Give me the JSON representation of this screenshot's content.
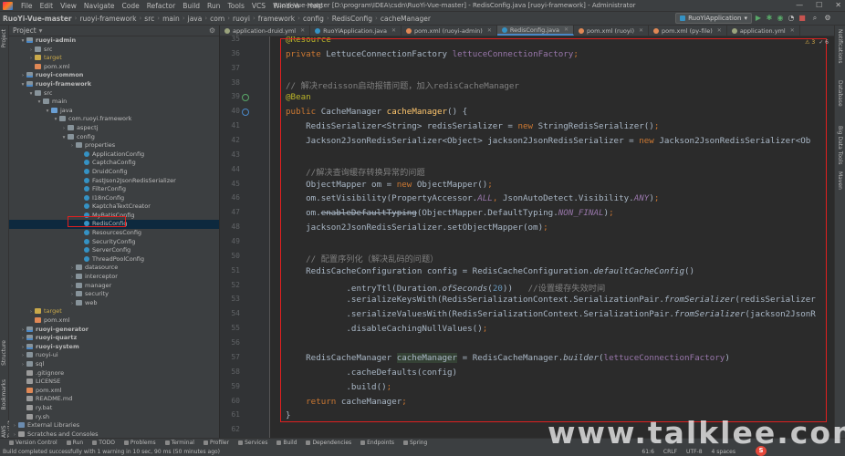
{
  "menubar": {
    "items": [
      "File",
      "Edit",
      "View",
      "Navigate",
      "Code",
      "Refactor",
      "Build",
      "Run",
      "Tools",
      "VCS",
      "Window",
      "Help"
    ],
    "window_title": "RuoYi-Vue-master [D:\\program\\IDEA\\csdn\\RuoYi-Vue-master] - RedisConfig.java [ruoyi-framework] - Administrator",
    "controls": [
      "—",
      "☐",
      "✕"
    ]
  },
  "navbar": {
    "crumbs": [
      "RuoYi-Vue-master",
      "ruoyi-framework",
      "src",
      "main",
      "java",
      "com",
      "ruoyi",
      "framework",
      "config",
      "RedisConfig",
      "cacheManager"
    ],
    "run_config": "RuoYiApplication"
  },
  "left_stripe": {
    "project": "Project",
    "structure": "Structure",
    "bookmarks": "Bookmarks",
    "aws": "AWS Toolkit"
  },
  "right_stripe": {
    "notifications": "Notifications",
    "database": "Database",
    "bigdata": "Big Data Tools",
    "maven": "Maven"
  },
  "project_panel": {
    "title": "Project",
    "tree": [
      {
        "label": "ruoyi-admin",
        "indent": 1,
        "icon": "mod",
        "bold": true,
        "arrow": "▾"
      },
      {
        "label": "src",
        "indent": 2,
        "icon": "folder",
        "arrow": "›"
      },
      {
        "label": "target",
        "indent": 2,
        "icon": "tgt",
        "arrow": "›",
        "tgt": true
      },
      {
        "label": "pom.xml",
        "indent": 2,
        "icon": "xml",
        "arrow": ""
      },
      {
        "label": "ruoyi-common",
        "indent": 1,
        "icon": "mod",
        "bold": true,
        "arrow": "›"
      },
      {
        "label": "ruoyi-framework",
        "indent": 1,
        "icon": "mod",
        "bold": true,
        "arrow": "▾"
      },
      {
        "label": "src",
        "indent": 2,
        "icon": "folder",
        "arrow": "▾"
      },
      {
        "label": "main",
        "indent": 3,
        "icon": "folder",
        "arrow": "▾"
      },
      {
        "label": "java",
        "indent": 4,
        "icon": "srcf",
        "arrow": "▾"
      },
      {
        "label": "com.ruoyi.framework",
        "indent": 5,
        "icon": "folder",
        "arrow": "▾"
      },
      {
        "label": "aspectj",
        "indent": 6,
        "icon": "folder",
        "arrow": "›"
      },
      {
        "label": "config",
        "indent": 6,
        "icon": "folder",
        "arrow": "▾"
      },
      {
        "label": "properties",
        "indent": 7,
        "icon": "folder",
        "arrow": "›"
      },
      {
        "label": "ApplicationConfig",
        "indent": 8,
        "icon": "cls",
        "arrow": ""
      },
      {
        "label": "CaptchaConfig",
        "indent": 8,
        "icon": "cls",
        "arrow": ""
      },
      {
        "label": "DruidConfig",
        "indent": 8,
        "icon": "cls",
        "arrow": ""
      },
      {
        "label": "FastJson2JsonRedisSerializer",
        "indent": 8,
        "icon": "cls",
        "arrow": ""
      },
      {
        "label": "FilterConfig",
        "indent": 8,
        "icon": "cls",
        "arrow": ""
      },
      {
        "label": "I18nConfig",
        "indent": 8,
        "icon": "cls",
        "arrow": ""
      },
      {
        "label": "KaptchaTextCreator",
        "indent": 8,
        "icon": "cls",
        "arrow": ""
      },
      {
        "label": "MyBatisConfig",
        "indent": 8,
        "icon": "cls",
        "arrow": ""
      },
      {
        "label": "RedisConfig",
        "indent": 8,
        "icon": "cls",
        "arrow": "",
        "sel": true
      },
      {
        "label": "ResourcesConfig",
        "indent": 8,
        "icon": "cls",
        "arrow": ""
      },
      {
        "label": "SecurityConfig",
        "indent": 8,
        "icon": "cls",
        "arrow": ""
      },
      {
        "label": "ServerConfig",
        "indent": 8,
        "icon": "cls",
        "arrow": ""
      },
      {
        "label": "ThreadPoolConfig",
        "indent": 8,
        "icon": "cls",
        "arrow": ""
      },
      {
        "label": "datasource",
        "indent": 7,
        "icon": "folder",
        "arrow": "›"
      },
      {
        "label": "interceptor",
        "indent": 7,
        "icon": "folder",
        "arrow": "›"
      },
      {
        "label": "manager",
        "indent": 7,
        "icon": "folder",
        "arrow": "›"
      },
      {
        "label": "security",
        "indent": 7,
        "icon": "folder",
        "arrow": "›"
      },
      {
        "label": "web",
        "indent": 7,
        "icon": "folder",
        "arrow": "›"
      },
      {
        "label": "target",
        "indent": 2,
        "icon": "tgt",
        "arrow": "›",
        "tgt": true
      },
      {
        "label": "pom.xml",
        "indent": 2,
        "icon": "xml",
        "arrow": ""
      },
      {
        "label": "ruoyi-generator",
        "indent": 1,
        "icon": "mod",
        "bold": true,
        "arrow": "›"
      },
      {
        "label": "ruoyi-quartz",
        "indent": 1,
        "icon": "mod",
        "bold": true,
        "arrow": "›"
      },
      {
        "label": "ruoyi-system",
        "indent": 1,
        "icon": "mod",
        "bold": true,
        "arrow": "›"
      },
      {
        "label": "ruoyi-ui",
        "indent": 1,
        "icon": "folder",
        "arrow": "›"
      },
      {
        "label": "sql",
        "indent": 1,
        "icon": "folder",
        "arrow": "›"
      },
      {
        "label": ".gitignore",
        "indent": 1,
        "icon": "file",
        "arrow": ""
      },
      {
        "label": "LICENSE",
        "indent": 1,
        "icon": "file",
        "arrow": ""
      },
      {
        "label": "pom.xml",
        "indent": 1,
        "icon": "xml",
        "arrow": ""
      },
      {
        "label": "README.md",
        "indent": 1,
        "icon": "file",
        "arrow": ""
      },
      {
        "label": "ry.bat",
        "indent": 1,
        "icon": "file",
        "arrow": ""
      },
      {
        "label": "ry.sh",
        "indent": 1,
        "icon": "file",
        "arrow": ""
      },
      {
        "label": "External Libraries",
        "indent": 0,
        "icon": "lib",
        "arrow": "›"
      },
      {
        "label": "Scratches and Consoles",
        "indent": 0,
        "icon": "file",
        "arrow": "›"
      }
    ]
  },
  "tabs": [
    {
      "label": "application-druid.yml",
      "icon": "#9aa37d",
      "active": false
    },
    {
      "label": "RuoYiApplication.java",
      "icon": "#3592c4",
      "active": false
    },
    {
      "label": "pom.xml (ruoyi-admin)",
      "icon": "#e08855",
      "active": false
    },
    {
      "label": "RedisConfig.java",
      "icon": "#3592c4",
      "active": true
    },
    {
      "label": "pom.xml (ruoyi)",
      "icon": "#e08855",
      "active": false
    },
    {
      "label": "pom.xml (py-file)",
      "icon": "#e08855",
      "active": false
    },
    {
      "label": "application.yml",
      "icon": "#9aa37d",
      "active": false
    }
  ],
  "editor": {
    "line_numbers": [
      "35",
      "36",
      "37",
      "38",
      "39",
      "40",
      "41",
      "42",
      "43",
      "44",
      "45",
      "46",
      "47",
      "48",
      "49",
      "50",
      "51",
      "52",
      "53",
      "54",
      "55",
      "56",
      "57",
      "58",
      "59",
      "60",
      "61",
      "62"
    ],
    "warnings": {
      "count_warn": "⚠ 3",
      "count_weak": "✓ 6"
    },
    "lines": [
      [
        {
          "t": "@Resource",
          "c": "an"
        }
      ],
      [
        {
          "t": "private ",
          "c": "kw"
        },
        {
          "t": "LettuceConnectionFactory "
        },
        {
          "t": "lettuceConnectionFactory",
          "c": "fl"
        },
        {
          "t": ";",
          "c": "kw"
        }
      ],
      [],
      [
        {
          "t": "// 解决redisson启动报错问题，加入redisCacheManager",
          "c": "cm"
        }
      ],
      [
        {
          "t": "@Bean",
          "c": "an"
        }
      ],
      [
        {
          "t": "public ",
          "c": "kw"
        },
        {
          "t": "CacheManager "
        },
        {
          "t": "cacheManager",
          "c": "fn"
        },
        {
          "t": "() {"
        }
      ],
      [
        {
          "t": "    RedisSerializer<String> redisSerializer = "
        },
        {
          "t": "new ",
          "c": "kw"
        },
        {
          "t": "StringRedisSerializer()"
        },
        {
          "t": ";",
          "c": "kw"
        }
      ],
      [
        {
          "t": "    Jackson2JsonRedisSerializer<Object> jackson2JsonRedisSerializer = "
        },
        {
          "t": "new ",
          "c": "kw"
        },
        {
          "t": "Jackson2JsonRedisSerializer<Ob"
        }
      ],
      [],
      [
        {
          "t": "    //解决查询缓存转换异常的问题",
          "c": "cm"
        }
      ],
      [
        {
          "t": "    ObjectMapper om = "
        },
        {
          "t": "new ",
          "c": "kw"
        },
        {
          "t": "ObjectMapper()"
        },
        {
          "t": ";",
          "c": "kw"
        }
      ],
      [
        {
          "t": "    om.setVisibility(PropertyAccessor."
        },
        {
          "t": "ALL",
          "c": "fl it"
        },
        {
          "t": ", ",
          "c": "kw"
        },
        {
          "t": "JsonAutoDetect.Visibility."
        },
        {
          "t": "ANY",
          "c": "fl it"
        },
        {
          "t": ")"
        },
        {
          "t": ";",
          "c": "kw"
        }
      ],
      [
        {
          "t": "    om."
        },
        {
          "t": "enableDefaultTyping",
          "c": "st"
        },
        {
          "t": "(ObjectMapper.DefaultTyping."
        },
        {
          "t": "NON_FINAL",
          "c": "fl it"
        },
        {
          "t": ")"
        },
        {
          "t": ";",
          "c": "kw"
        }
      ],
      [
        {
          "t": "    jackson2JsonRedisSerializer.setObjectMapper(om)"
        },
        {
          "t": ";",
          "c": "kw"
        }
      ],
      [],
      [
        {
          "t": "    // 配置序列化（解决乱码的问题）",
          "c": "cm"
        }
      ],
      [
        {
          "t": "    RedisCacheConfiguration config = RedisCacheConfiguration."
        },
        {
          "t": "defaultCacheConfig",
          "c": "it"
        },
        {
          "t": "()"
        }
      ],
      [
        {
          "t": "            .entryTtl(Duration."
        },
        {
          "t": "ofSeconds",
          "c": "it"
        },
        {
          "t": "("
        },
        {
          "t": "20",
          "c": "nm"
        },
        {
          "t": "))   "
        },
        {
          "t": "//设置缓存失效时间",
          "c": "cm"
        }
      ],
      [
        {
          "t": "            .serializeKeysWith(RedisSerializationContext.SerializationPair."
        },
        {
          "t": "fromSerializer",
          "c": "it"
        },
        {
          "t": "(redisSerializer"
        }
      ],
      [
        {
          "t": "            .serializeValuesWith(RedisSerializationContext.SerializationPair."
        },
        {
          "t": "fromSerializer",
          "c": "it"
        },
        {
          "t": "(jackson2JsonR"
        }
      ],
      [
        {
          "t": "            .disableCachingNullValues()"
        },
        {
          "t": ";",
          "c": "kw"
        }
      ],
      [],
      [
        {
          "t": "    RedisCacheManager "
        },
        {
          "t": "cacheManager",
          "c": "hlv"
        },
        {
          "t": " = RedisCacheManager."
        },
        {
          "t": "builder",
          "c": "it"
        },
        {
          "t": "("
        },
        {
          "t": "lettuceConnectionFactory",
          "c": "fl"
        },
        {
          "t": ")"
        }
      ],
      [
        {
          "t": "            .cacheDefaults(config)"
        }
      ],
      [
        {
          "t": "            .build()"
        },
        {
          "t": ";",
          "c": "kw"
        }
      ],
      [
        {
          "t": "    "
        },
        {
          "t": "return ",
          "c": "kw"
        },
        {
          "t": "cacheManager"
        },
        {
          "t": ";",
          "c": "kw"
        }
      ],
      [
        {
          "t": "}"
        }
      ],
      []
    ]
  },
  "bottom_tools": [
    "Version Control",
    "Run",
    "TODO",
    "Problems",
    "Terminal",
    "Profiler",
    "Services",
    "Build",
    "Dependencies",
    "Endpoints",
    "Spring"
  ],
  "status": {
    "message": "Build completed successfully with 1 warning in 10 sec, 90 ms (50 minutes ago)",
    "position": "61:6",
    "line_sep": "CRLF",
    "encoding": "UTF-8",
    "indent": "4 spaces"
  },
  "watermark": "www.talklee.com"
}
